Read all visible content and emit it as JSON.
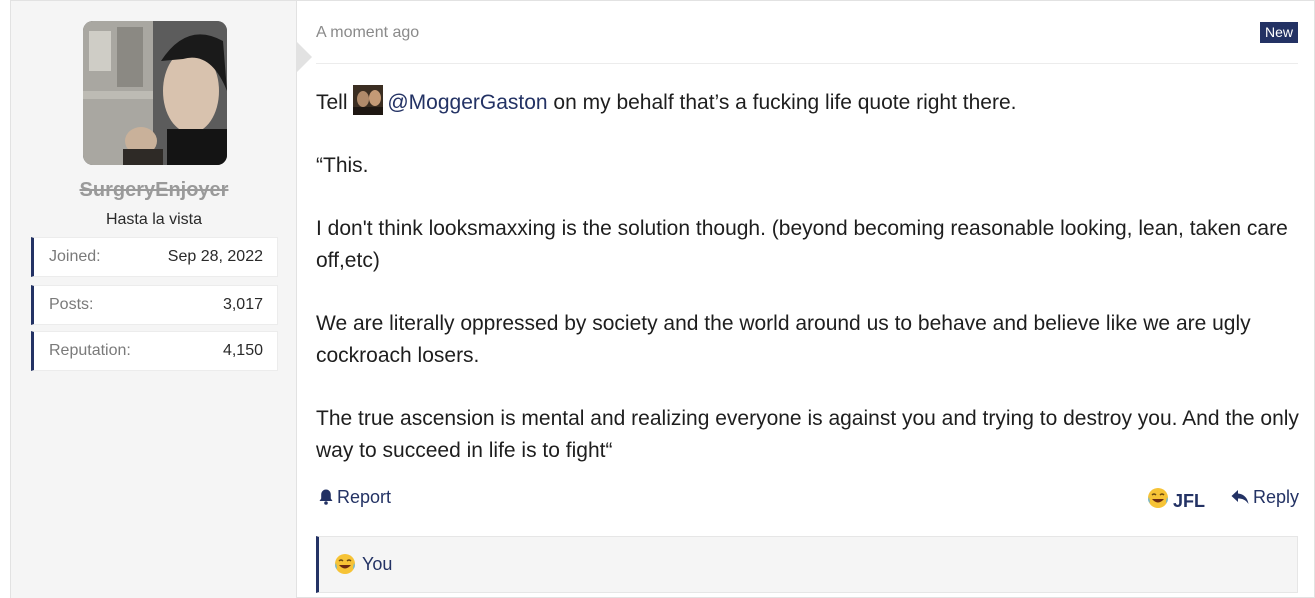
{
  "post": {
    "timestamp": "A moment ago",
    "badge": "New",
    "body": {
      "line1_prefix": "Tell ",
      "mention": "@MoggerGaston",
      "line1_suffix": " on my behalf that’s a fucking life quote right there.",
      "p2": "“This.",
      "p3": "I don't think looksmaxxing is the solution though. (beyond becoming reasonable looking, lean, taken care off,etc)",
      "p4": "We are literally oppressed by society and the world around us to behave and believe like we are ugly cockroach losers.",
      "p5": "The true ascension is mental and realizing everyone is against you and trying to destroy you. And the only way to succeed in life is to fight“"
    },
    "actions": {
      "report": "Report",
      "jfl": "JFL",
      "reply": "Reply"
    },
    "reactions": {
      "who": "You",
      "icon": "laughing-crying-emoji-icon"
    }
  },
  "user": {
    "username": "SurgeryEnjoyer",
    "title": "Hasta la vista",
    "stats": [
      {
        "label": "Joined:",
        "value": "Sep 28, 2022"
      },
      {
        "label": "Posts:",
        "value": "3,017"
      },
      {
        "label": "Reputation:",
        "value": "4,150"
      }
    ]
  },
  "colors": {
    "accent": "#233264",
    "sidebar_bg": "#f5f5f5",
    "username": "#9a9a9a"
  }
}
